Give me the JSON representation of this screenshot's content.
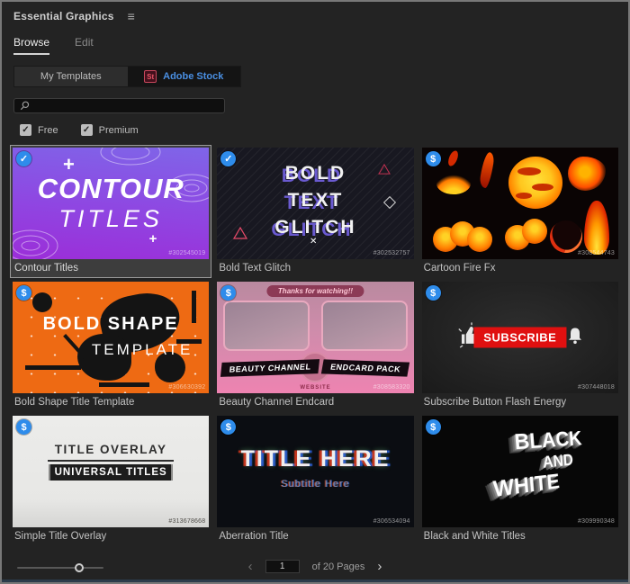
{
  "panel": {
    "title": "Essential Graphics",
    "menu_icon": "≡",
    "tabs": {
      "browse": "Browse",
      "edit": "Edit"
    },
    "sources": {
      "my_templates": "My Templates",
      "adobe_stock": "Adobe Stock",
      "stock_logo": "St"
    },
    "search": {
      "value": "",
      "placeholder": ""
    },
    "filters": {
      "free": "Free",
      "premium": "Premium",
      "check_glyph": "✓"
    }
  },
  "templates": [
    {
      "label": "Contour Titles",
      "id": "#302545019",
      "badge": "✓",
      "selected": true,
      "thumb": {
        "line1": "CONTOUR",
        "line2": "TITLES",
        "plus": "+"
      }
    },
    {
      "label": "Bold Text Glitch",
      "id": "#302532757",
      "badge": "✓",
      "thumb": {
        "line1": "BOLD",
        "line2": "TEXT",
        "line3": "GLITCH",
        "cross": "✕"
      }
    },
    {
      "label": "Cartoon Fire Fx",
      "id": "#308544743",
      "badge": "$",
      "thumb": {}
    },
    {
      "label": "Bold Shape Title Template",
      "id": "#306630392",
      "badge": "$",
      "thumb": {
        "line1": "BOLD SHAPE",
        "line2": "TEMPLATE"
      }
    },
    {
      "label": "Beauty Channel Endcard",
      "id": "#308583320",
      "badge": "$",
      "thumb": {
        "banner": "Thanks for watching!!",
        "left_banner": "BEAUTY CHANNEL",
        "right_banner": "ENDCARD PACK",
        "website": "WEBSITE"
      }
    },
    {
      "label": "Subscribe Button Flash Energy",
      "id": "#307448018",
      "badge": "$",
      "thumb": {
        "button": "SUBSCRIBE"
      }
    },
    {
      "label": "Simple Title Overlay",
      "id": "#313678668",
      "badge": "$",
      "thumb": {
        "line1": "TITLE OVERLAY",
        "line2": "UNIVERSAL TITLES"
      }
    },
    {
      "label": "Aberration Title",
      "id": "#306534094",
      "badge": "$",
      "thumb": {
        "line1": "TITLE HERE",
        "line2": "Subtitle Here"
      }
    },
    {
      "label": "Black and White Titles",
      "id": "#309990348",
      "badge": "$",
      "thumb": {
        "line1": "BLACK",
        "line2": "AND",
        "line3": "WHITE"
      }
    }
  ],
  "pagination": {
    "prev": "‹",
    "page": "1",
    "label": "of 20 Pages",
    "next": "›"
  },
  "colors": {
    "accent_blue": "#2e8ceb",
    "stock_text_blue": "#4a8fe2",
    "subscribe_red": "#e01010",
    "selected_border": "#9a9a9a"
  }
}
